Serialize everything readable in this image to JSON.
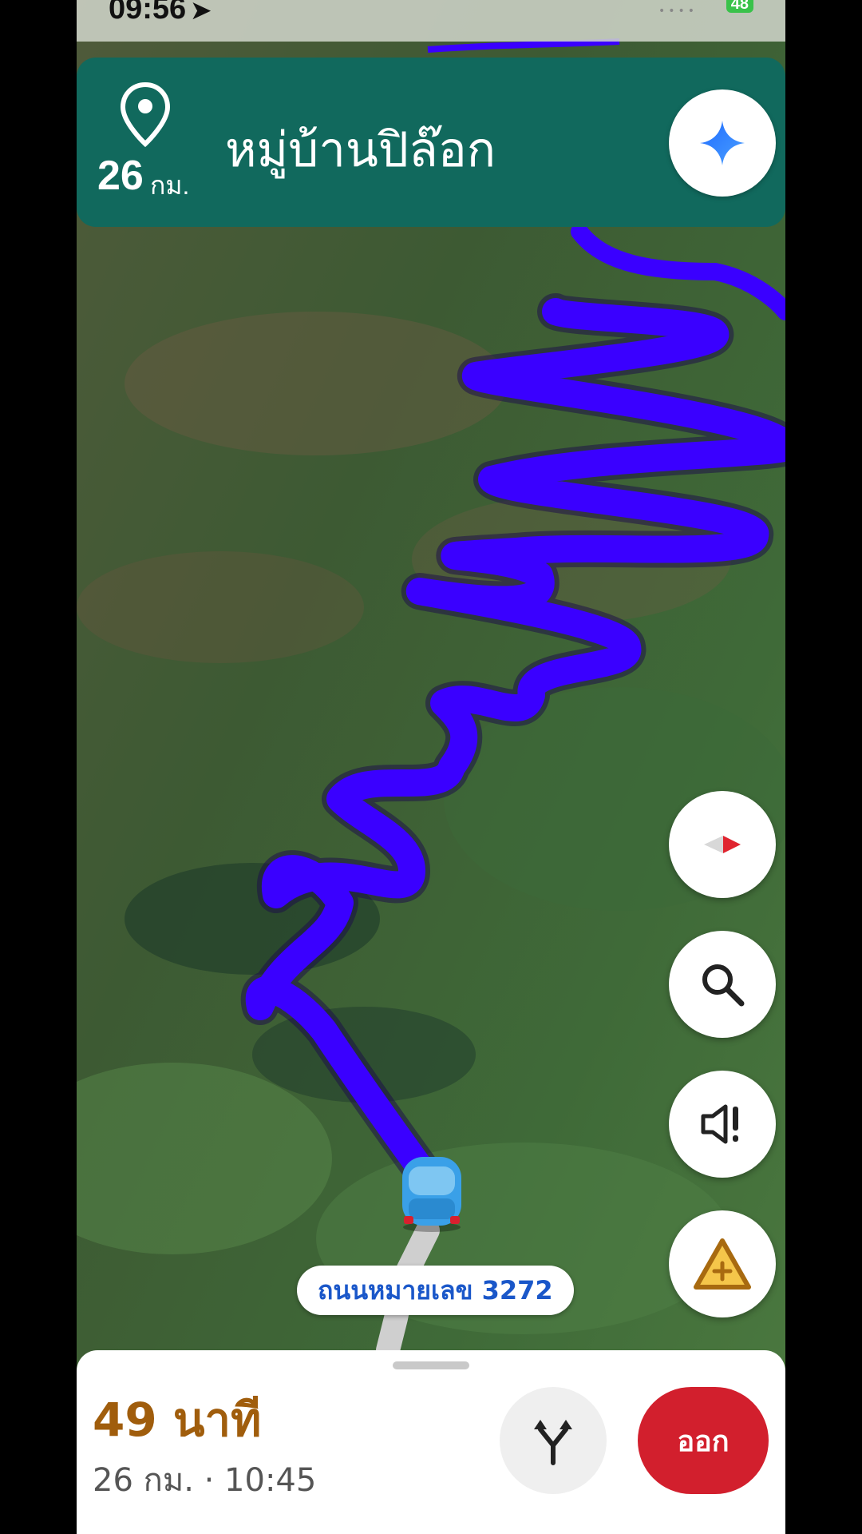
{
  "status_bar": {
    "time": "09:56",
    "battery": "48"
  },
  "header": {
    "distance_value": "26",
    "distance_unit": "กม.",
    "destination": "หมู่บ้านปิล๊อก",
    "background_color": "#11695d"
  },
  "map": {
    "route_color": "#3a00ff",
    "current_road": "ถนนหมายเลข 3272"
  },
  "controls": {
    "icons": [
      "gemini-sparkle-icon",
      "compass-icon",
      "search-icon",
      "sound-alert-icon",
      "add-report-icon"
    ]
  },
  "bottom_sheet": {
    "duration": "49 นาที",
    "details": "26 กม. · 10:45",
    "exit_label": "ออก",
    "exit_color": "#d21f2d"
  }
}
